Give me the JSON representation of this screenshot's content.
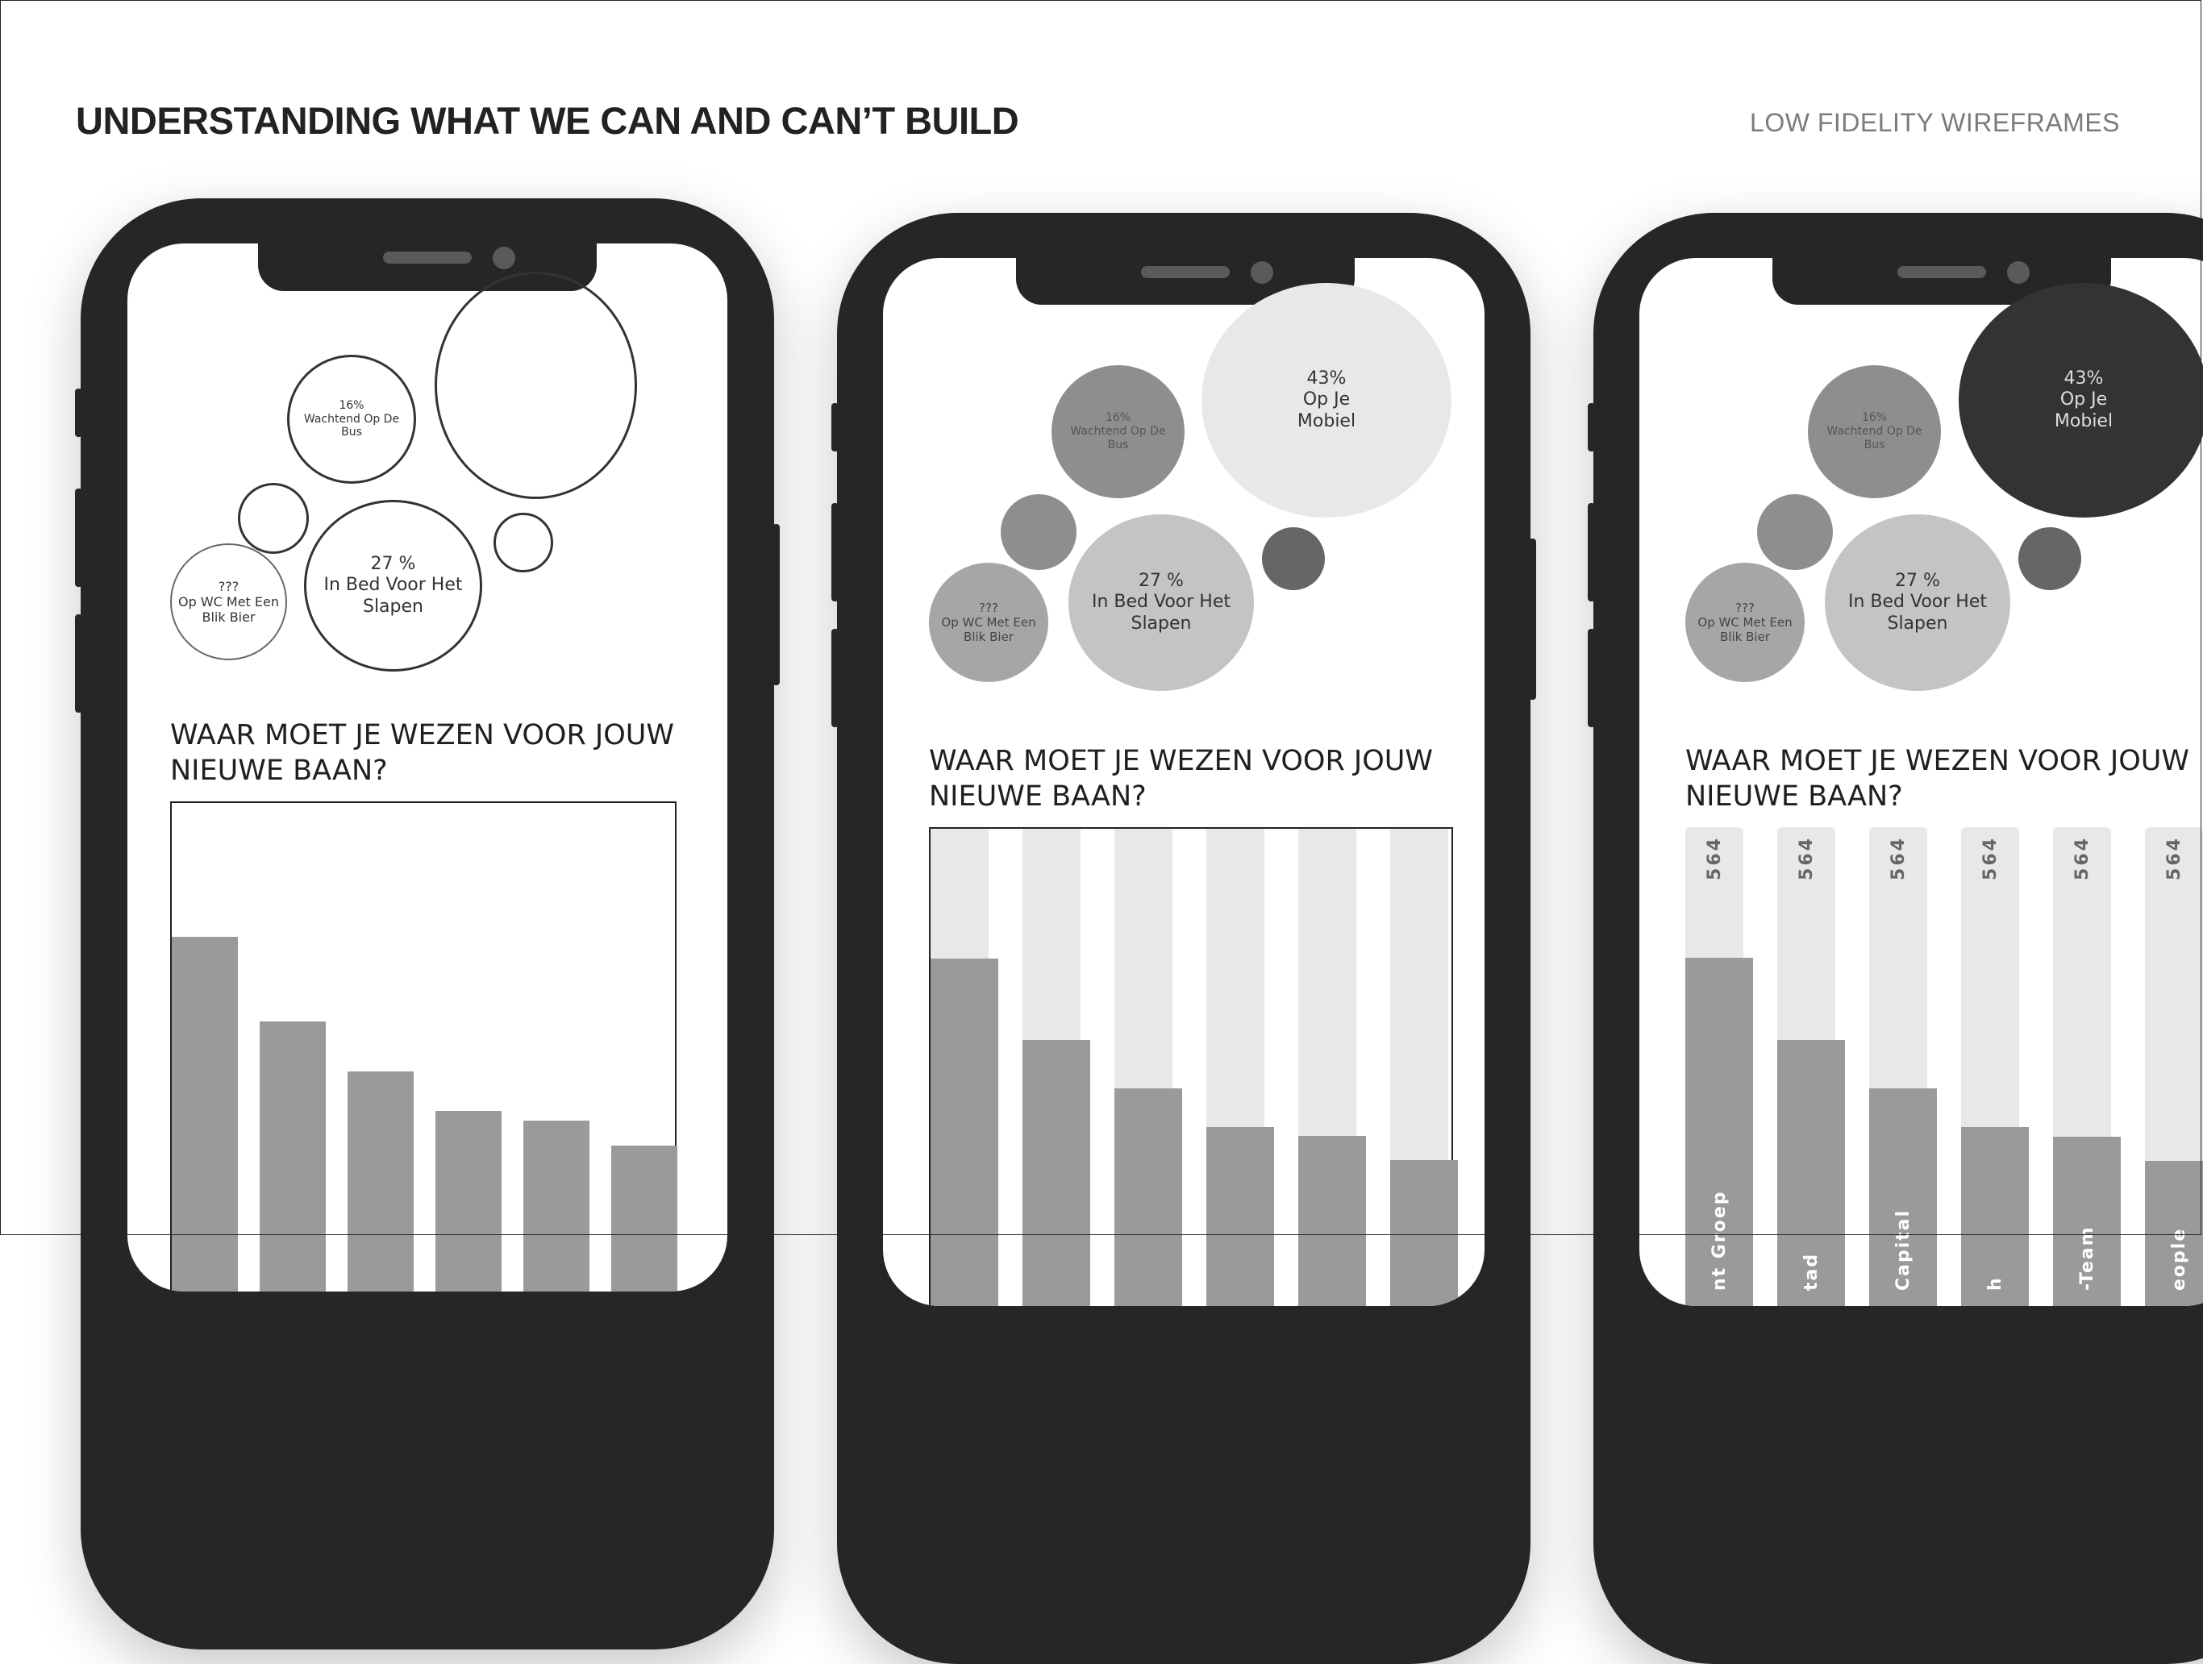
{
  "slide": {
    "title": "UNDERSTANDING WHAT WE CAN AND CAN’T BUILD",
    "subtitle": "LOW FIDELITY WIREFRAMES"
  },
  "screen": {
    "bubbles": {
      "bus": {
        "pct": "16%",
        "line1": "Wachtend Op De",
        "line2": "Bus"
      },
      "mobiel": {
        "pct": "43%",
        "line1": "Op Je",
        "line2": "Mobiel"
      },
      "bed": {
        "pct": "27 %",
        "line1": "In Bed Voor Het",
        "line2": "Slapen"
      },
      "wc": {
        "pct": "???",
        "line1": "Op WC Met Een",
        "line2": "Blik Bier"
      }
    },
    "heading_line1": "WAAR MOET JE WEZEN VOOR JOUW",
    "heading_line2": "NIEUWE BAAN?"
  },
  "chart_data": {
    "type": "bar",
    "categories": [
      "nt Groep",
      "tad",
      "Capital",
      "h",
      "-Team",
      "eople"
    ],
    "values": [
      564,
      564,
      564,
      564,
      564,
      564
    ],
    "bar_levels": [
      0.73,
      0.56,
      0.46,
      0.38,
      0.36,
      0.31
    ],
    "value_labels": [
      "564",
      "564",
      "564",
      "564",
      "564",
      "564"
    ]
  },
  "colors": {
    "phone_body": "#262626",
    "bar": "#9a9a9a",
    "track": "#e8e8e8",
    "bubble_dark": "#333333"
  }
}
